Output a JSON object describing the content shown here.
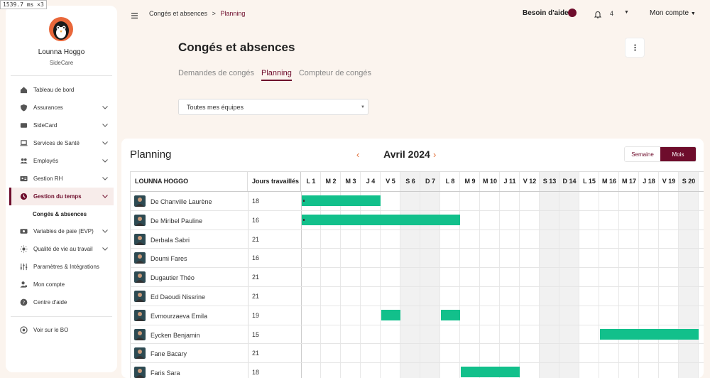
{
  "perf_badge": "1539.7 ms ×3",
  "user": {
    "name": "Lounna Hoggo",
    "company": "SideCare"
  },
  "nav": [
    {
      "label": "Tableau de bord",
      "icon": "home-icon",
      "chevron": false
    },
    {
      "label": "Assurances",
      "icon": "shield-icon",
      "chevron": true
    },
    {
      "label": "SideCard",
      "icon": "card-icon",
      "chevron": true
    },
    {
      "label": "Services de Santé",
      "icon": "laptop-icon",
      "chevron": true
    },
    {
      "label": "Employés",
      "icon": "users-icon",
      "chevron": true
    },
    {
      "label": "Gestion RH",
      "icon": "id-card-icon",
      "chevron": true
    },
    {
      "label": "Gestion du temps",
      "icon": "clock-icon",
      "chevron": true,
      "active": true
    },
    {
      "label": "Congés & absences",
      "sub": true
    },
    {
      "label": "Variables de paie (EVP)",
      "icon": "payroll-icon",
      "chevron": true
    },
    {
      "label": "Qualité de vie au travail",
      "icon": "sun-icon",
      "chevron": true
    },
    {
      "label": "Paramètres & Intégrations",
      "icon": "sliders-icon",
      "chevron": false
    },
    {
      "label": "Mon compte",
      "icon": "user-gear-icon",
      "chevron": false
    },
    {
      "label": "Centre d'aide",
      "icon": "help-icon",
      "chevron": false
    }
  ],
  "nav_footer": {
    "label": "Voir sur le BO",
    "icon": "eye-icon"
  },
  "breadcrumb": {
    "parent": "Congés et absences",
    "separator": ">",
    "current": "Planning"
  },
  "header": {
    "help": "Besoin d'aide",
    "notif_count": "4",
    "account": "Mon compte"
  },
  "page": {
    "title": "Congés et absences",
    "tabs": [
      "Demandes de congés",
      "Planning",
      "Compteur de congés"
    ],
    "active_tab": 1,
    "team_select": "Toutes mes équipes"
  },
  "planning": {
    "title": "Planning",
    "month": "Avril 2024",
    "view_week": "Semaine",
    "view_month": "Mois",
    "col_name": "LOUNNA HOGGO",
    "col_days": "Jours travaillés",
    "days": [
      "L 1",
      "M 2",
      "M 3",
      "J 4",
      "V 5",
      "S 6",
      "D 7",
      "L 8",
      "M 9",
      "M 10",
      "J 11",
      "V 12",
      "S 13",
      "D 14",
      "L 15",
      "M 16",
      "M 17",
      "J 18",
      "V 19",
      "S 20"
    ],
    "weekend": [
      5,
      6,
      12,
      13,
      19
    ],
    "employees": [
      {
        "name": "De Chanville Laurène",
        "days": "18",
        "absences": [
          [
            0,
            3
          ]
        ]
      },
      {
        "name": "De Miribel Pauline",
        "days": "16",
        "absences": [
          [
            0,
            7
          ]
        ]
      },
      {
        "name": "Derbala Sabri",
        "days": "21",
        "absences": []
      },
      {
        "name": "Doumi Fares",
        "days": "16",
        "absences": []
      },
      {
        "name": "Dugautier Théo",
        "days": "21",
        "absences": []
      },
      {
        "name": "Ed Daoudi Nissrine",
        "days": "21",
        "absences": []
      },
      {
        "name": "Evmourzaeva Emila",
        "days": "19",
        "absences": [
          [
            4,
            4
          ],
          [
            7,
            7
          ]
        ]
      },
      {
        "name": "Eycken Benjamin",
        "days": "15",
        "absences": [
          [
            15,
            19
          ]
        ]
      },
      {
        "name": "Fane Bacary",
        "days": "21",
        "absences": []
      },
      {
        "name": "Faris Sara",
        "days": "18",
        "absences": [
          [
            8,
            10
          ]
        ]
      }
    ]
  },
  "colors": {
    "accent": "#6e0d2c",
    "absence": "#12c08b",
    "arrow": "#e2703a"
  }
}
